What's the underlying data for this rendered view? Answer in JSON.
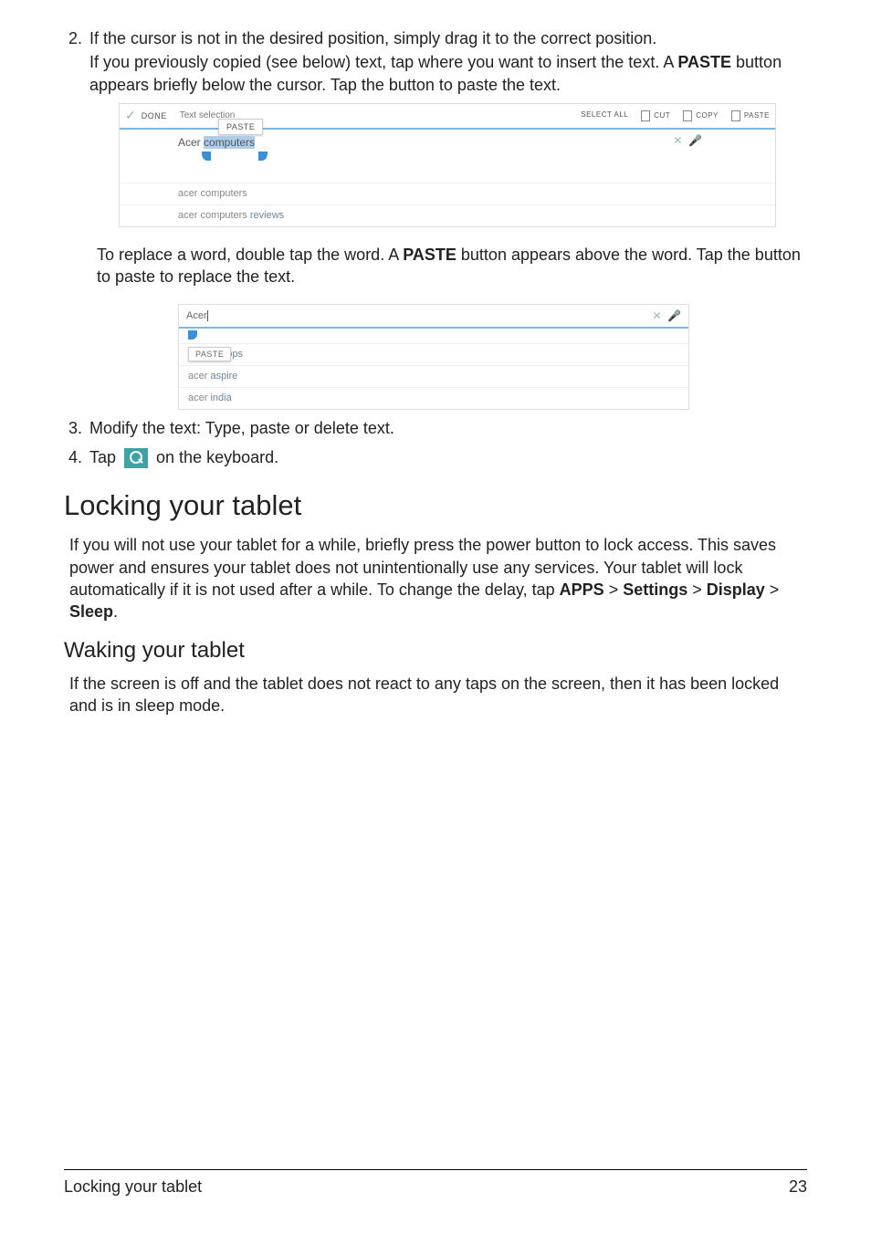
{
  "item2": {
    "num": "2.",
    "p1a": "If the cursor is not in the desired position, simply drag it to the correct position.",
    "p1b": "If you previously copied (see below) text, tap where you want to insert the text. A ",
    "paste_bold": "PASTE",
    "p1c": " button appears briefly below the cursor. Tap the button to paste the text."
  },
  "shot1": {
    "done": "DONE",
    "text_selection": "Text selection",
    "paste_chip": "PASTE",
    "tools": {
      "select_all": "SELECT ALL",
      "cut": "CUT",
      "copy": "COPY",
      "paste": "PASTE"
    },
    "line_prefix": "Acer ",
    "line_hl": "computers",
    "sug1": "acer computers",
    "sug2_pre": "acer computers ",
    "sug2_suf": "reviews",
    "x": "✕",
    "mic": "🎤"
  },
  "replace": {
    "p_a": "To replace a word, double tap the word. A ",
    "bold": "PASTE",
    "p_b": " button appears above the word. Tap the button to paste to replace the text."
  },
  "shot2": {
    "input": "Acer",
    "paste": "PASTE",
    "s1_pre": "acer ",
    "s1_suf": "laptops",
    "s2_pre": "acer ",
    "s2_suf": "aspire",
    "s3_pre": "acer ",
    "s3_suf": "india",
    "x": "✕",
    "mic": "🎤"
  },
  "item3": {
    "num": "3.",
    "text": "Modify the text: Type, paste or delete text."
  },
  "item4": {
    "num": "4.",
    "a": "Tap ",
    "b": " on the keyboard."
  },
  "h_lock": "Locking your tablet",
  "lock_p": {
    "a": "If you will not use your tablet for a while, briefly press the power button to lock access. This saves power and ensures your tablet does not unintentionally use any services. Your tablet will lock automatically if it is not used after a while. To change the delay, tap ",
    "apps": "APPS",
    "gt1": " > ",
    "settings": "Settings",
    "gt2": " > ",
    "display": "Display",
    "gt3": " > ",
    "sleep": "Sleep",
    "dot": "."
  },
  "h_wake": "Waking your tablet",
  "wake_p": "If the screen is off and the tablet does not react to any taps on the screen, then it has been locked and is in sleep mode.",
  "footer": {
    "left": "Locking your tablet",
    "right": "23"
  }
}
